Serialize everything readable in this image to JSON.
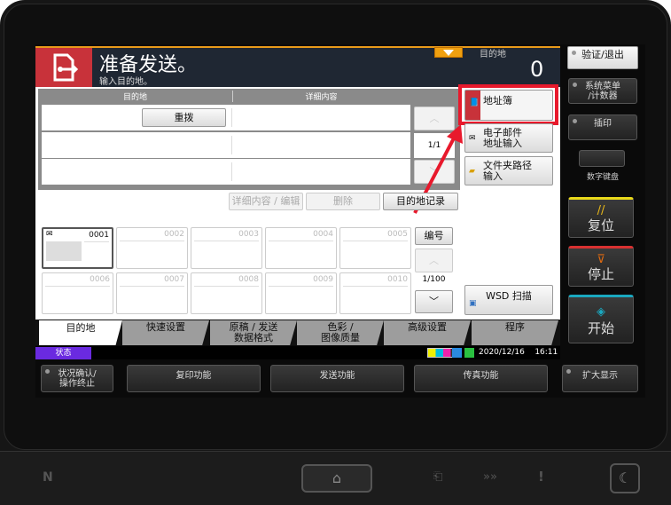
{
  "header": {
    "title": "准备发送。",
    "subtitle": "输入目的地。",
    "dest_label": "目的地",
    "dest_count": "0"
  },
  "dest_table": {
    "col_dest": "目的地",
    "col_detail": "详细内容",
    "redial": "重拨",
    "page": "1/1"
  },
  "side_buttons": {
    "address_book": "地址簿",
    "email_line1": "电子邮件",
    "email_line2": "地址输入",
    "folder_line1": "文件夹路径",
    "folder_line2": "输入",
    "wsd": "WSD 扫描"
  },
  "actions": {
    "detail_edit": "详细内容 / 编辑",
    "delete": "删除",
    "history": "目的地记录"
  },
  "onetouch": {
    "cells": [
      "0001",
      "0002",
      "0003",
      "0004",
      "0005",
      "0006",
      "0007",
      "0008",
      "0009",
      "0010"
    ],
    "number_btn": "编号",
    "page": "1/100"
  },
  "tabs": [
    {
      "l1": "目的地",
      "l2": ""
    },
    {
      "l1": "快速设置",
      "l2": ""
    },
    {
      "l1": "原稿 / 发送",
      "l2": "数据格式"
    },
    {
      "l1": "色彩 /",
      "l2": "图像质量"
    },
    {
      "l1": "高级设置",
      "l2": ""
    },
    {
      "l1": "程序",
      "l2": ""
    }
  ],
  "status": {
    "label": "状态",
    "datetime": "2020/12/16    16:11"
  },
  "function_bar": {
    "status_l1": "状况确认/",
    "status_l2": "操作终止",
    "copy": "复印功能",
    "send": "发送功能",
    "fax": "传真功能",
    "zoom": "扩大显示"
  },
  "right_panel": {
    "auth": "验证/退出",
    "sysmenu_l1": "系统菜单",
    "sysmenu_l2": "/计数器",
    "interrupt": "插印",
    "keypad": "数字键盘",
    "reset": "复位",
    "stop": "停止",
    "start": "开始"
  },
  "colors": {
    "header": "#1f2733",
    "red": "#c8323a",
    "highlight": "#e8192c",
    "reset": "#e8d81a",
    "stop": "#d83030",
    "start": "#1aa8c0",
    "status": "#6a2ae0"
  }
}
